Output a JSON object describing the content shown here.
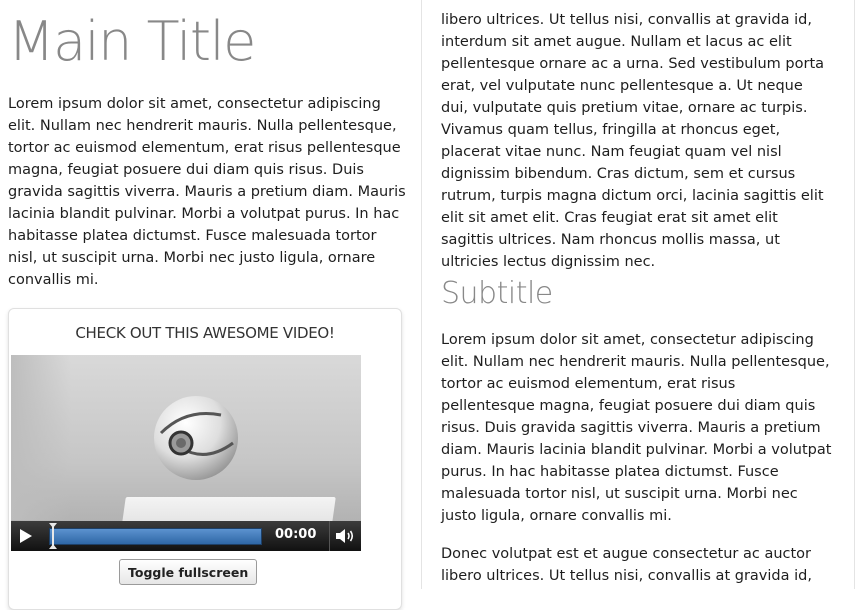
{
  "left": {
    "title": "Main Title",
    "paragraph": "Lorem ipsum dolor sit amet, consectetur adipiscing elit. Nullam nec hendrerit mauris. Nulla pellentesque, tortor ac euismod elementum, erat risus pellentesque magna, feugiat posuere dui diam quis risus. Duis gravida sagittis viverra. Mauris a pretium diam. Mauris lacinia blandit pulvinar. Morbi a volutpat purus. In hac habitasse platea dictumst. Fusce malesuada tortor nisl, ut suscipit urna. Morbi nec justo ligula, ornare convallis mi."
  },
  "video": {
    "heading": "CHECK OUT THIS AWESOME VIDEO!",
    "time": "00:00",
    "fullscreen_label": "Toggle fullscreen",
    "icons": {
      "play": "play-icon",
      "volume": "volume-icon",
      "scrubber": "scrubber-handle"
    },
    "progress_accent": "#3f7fc4"
  },
  "right": {
    "paragraph_1": "libero ultrices. Ut tellus nisi, convallis at gravida id, interdum sit amet augue. Nullam et lacus ac elit pellentesque ornare ac a urna. Sed vestibulum porta erat, vel vulputate nunc pellentesque a. Ut neque dui, vulputate quis pretium vitae, ornare ac turpis. Vivamus quam tellus, fringilla at rhoncus eget, placerat vitae nunc. Nam feugiat quam vel nisl dignissim bibendum. Cras dictum, sem et cursus rutrum, turpis magna dictum orci, lacinia sagittis elit elit sit amet elit. Cras feugiat erat sit amet elit sagittis ultrices. Nam rhoncus mollis massa, ut ultricies lectus dignissim nec.",
    "subtitle": "Subtitle",
    "paragraph_2": "Lorem ipsum dolor sit amet, consectetur adipiscing elit. Nullam nec hendrerit mauris. Nulla pellentesque, tortor ac euismod elementum, erat risus pellentesque magna, feugiat posuere dui diam quis risus. Duis gravida sagittis viverra. Mauris a pretium diam. Mauris lacinia blandit pulvinar. Morbi a volutpat purus. In hac habitasse platea dictumst. Fusce malesuada tortor nisl, ut suscipit urna. Morbi nec justo ligula, ornare convallis mi.",
    "paragraph_3": "Donec volutpat est et augue consectetur ac auctor libero ultrices. Ut tellus nisi, convallis at gravida id,"
  }
}
